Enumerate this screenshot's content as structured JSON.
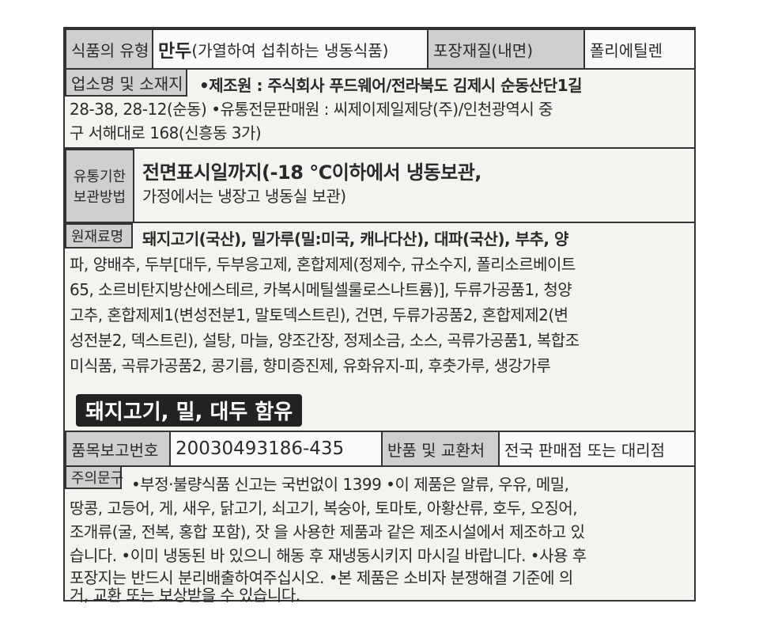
{
  "row1": {
    "type_label": "식품의 유형",
    "type_value_bold": "만두",
    "type_value": "(가열하여 섭취하는 냉동식품)",
    "pack_label": "포장재질(내면)",
    "pack_value": "폴리에틸렌"
  },
  "address": {
    "label": "업소명 및 소재지",
    "lines": [
      "•제조원 : 주식회사 푸드웨어/전라북도 김제시 순동산단1길",
      "28-38, 28-12(순동) •유통전문판매원 : 씨제이제일제당(주)/인천광역시 중",
      "구 서해대로 168(신흥동 3가)"
    ]
  },
  "storage": {
    "label_line1": "유통기한",
    "label_line2": "보관방법",
    "line1": "전면표시일까지(-18 ℃이하에서 냉동보관,",
    "line2": "가정에서는 냉장고 냉동실 보관)"
  },
  "ingredients": {
    "label": "원재료명",
    "lines": [
      "돼지고기(국산), 밀가루(밀:미국, 캐나다산), 대파(국산), 부추, 양",
      "파, 양배추, 두부[대두, 두부응고제, 혼합제제(정제수, 규소수지, 폴리소르베이트",
      "65, 소르비탄지방산에스테르, 카복시메틸셀룰로스나트륨)], 두류가공품1, 청양",
      "고추, 혼합제제1(변성전분1, 말토덱스트린), 건면, 두류가공품2, 혼합제제2(변",
      "성전분2, 덱스트린), 설탕, 마늘, 양조간장, 정제소금, 소스, 곡류가공품1, 복합조",
      "미식품, 곡류가공품2, 콩기름, 향미증진제, 유화유지-피, 후춧가루, 생강가루"
    ],
    "allergen": "돼지고기, 밀, 대두 함유"
  },
  "report": {
    "label": "품목보고번호",
    "value": "20030493186-435",
    "return_label": "반품 및 교환처",
    "return_value": "전국 판매점 또는 대리점"
  },
  "caution": {
    "label": "주의문구",
    "lines": [
      "•부정·불량식품 신고는 국번없이 1399 •이 제품은 알류, 우유, 메밀,",
      "땅콩, 고등어, 게, 새우, 닭고기, 쇠고기, 복숭아, 토마토, 아황산류, 호두, 오징어,",
      "조개류(굴, 전복, 홍합 포함), 잣 을 사용한 제품과 같은 제조시설에서 제조하고 있",
      "습니다. •이미 냉동된 바 있으니 해동 후 재냉동시키지 마시길 바랍니다. •사용 후",
      "포장지는 반드시 분리배출하여주십시오. •본 제품은 소비자 분쟁해결 기준에 의",
      "거, 교환 또는 보상받을 수 있습니다."
    ]
  }
}
